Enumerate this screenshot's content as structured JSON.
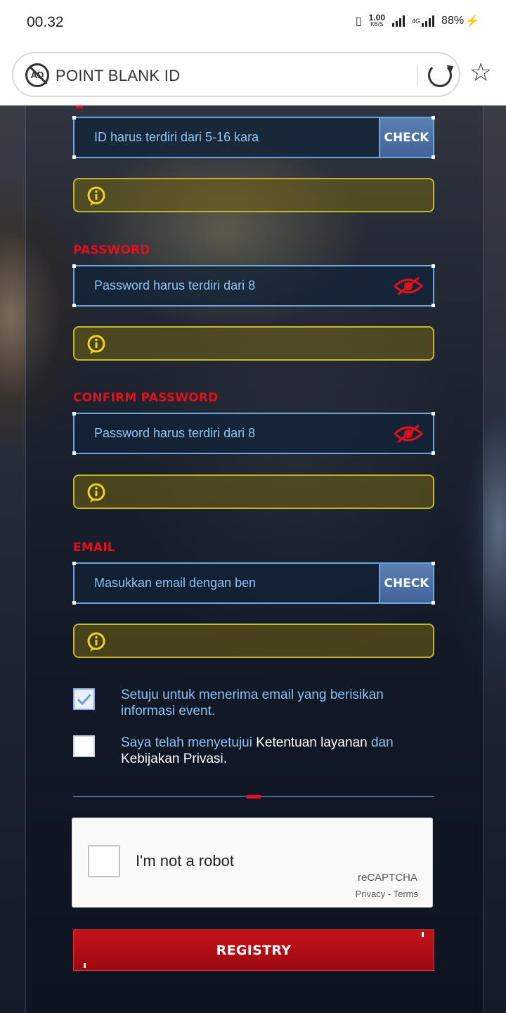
{
  "status_bar": {
    "time": "00.32",
    "speed_value": "1.00",
    "speed_unit": "KB/S",
    "network": "4G",
    "battery": "88%"
  },
  "browser": {
    "url_title": "POINT BLANK ID",
    "ad_icon_text": "AD"
  },
  "form": {
    "id_field": {
      "placeholder": "ID harus terdiri dari 5-16 kara",
      "check_label": "CHECK"
    },
    "password": {
      "label": "PASSWORD",
      "placeholder": "Password harus terdiri dari 8"
    },
    "confirm_password": {
      "label": "CONFIRM PASSWORD",
      "placeholder": "Password harus terdiri dari 8"
    },
    "email": {
      "label": "EMAIL",
      "placeholder": "Masukkan email dengan ben",
      "check_label": "CHECK"
    },
    "agree_email": {
      "checked": true,
      "text": "Setuju untuk menerima email yang berisikan informasi event."
    },
    "agree_terms": {
      "checked": false,
      "text_1": "Saya telah menyetujui",
      "text_2": "Ketentuan layanan",
      "text_3": "dan",
      "text_4": "Kebijakan Privasi."
    }
  },
  "recaptcha": {
    "label": "I'm not a robot",
    "brand": "reCAPTCHA",
    "privacy": "Privacy",
    "separator": "-",
    "terms": "Terms"
  },
  "registry_button": {
    "label": "REGISTRY"
  },
  "colors": {
    "label_red": "#e0111c",
    "input_border": "#6aa7e2",
    "info_border": "#c8b62a",
    "button_red": "#c41119"
  }
}
